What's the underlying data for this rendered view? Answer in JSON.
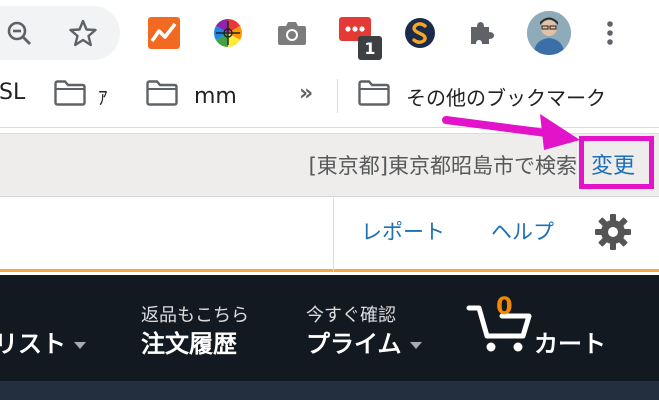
{
  "toolbar": {
    "zoom_icon": "zoom-out-icon",
    "star_icon": "bookmark-star-icon",
    "extension_badge": "1",
    "icons": [
      "analytics-extension-icon",
      "color-wheel-extension-icon",
      "camera-extension-icon",
      "chat-extension-icon",
      "s-extension-icon",
      "puzzle-extensions-icon",
      "profile-avatar",
      "kebab-menu-icon"
    ]
  },
  "bookmarks": {
    "items": [
      {
        "label": "SL"
      },
      {
        "label": "ｱ"
      },
      {
        "label": "mm"
      }
    ],
    "overflow": "»",
    "other": "その他のブックマーク"
  },
  "location": {
    "text": "[東京都]東京都昭島市で検索",
    "change_label": "変更"
  },
  "secondary": {
    "report": "レポート",
    "help": "ヘルプ"
  },
  "nav": {
    "list_label": "リスト",
    "orders_line1": "返品もこちら",
    "orders_line2": "注文履歴",
    "prime_line1": "今すぐ確認",
    "prime_line2": "プライム",
    "cart_count": "0",
    "cart_label": "カート"
  },
  "colors": {
    "highlight": "#e213c9",
    "link": "#1f6fb6",
    "nav_bg": "#131921",
    "accent_orange": "#f3a847",
    "cart_orange": "#f08804"
  }
}
